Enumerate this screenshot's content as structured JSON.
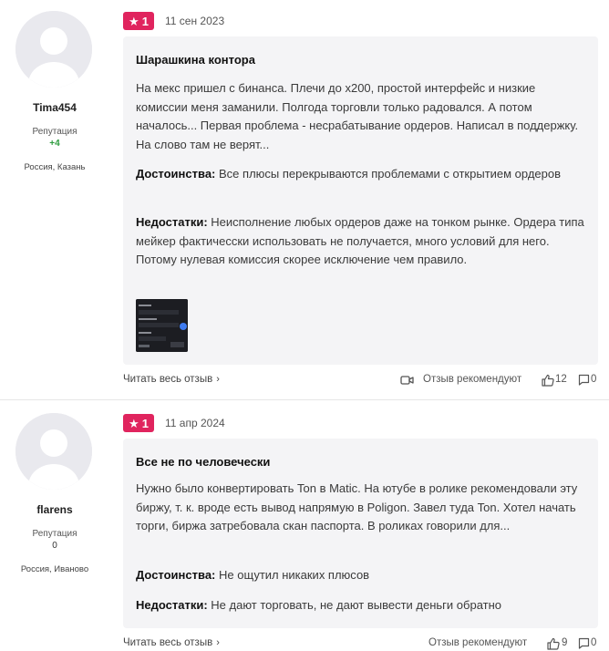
{
  "reviews": [
    {
      "author": "Tima454",
      "reputation_label": "Репутация",
      "reputation_value": "+4",
      "location": "Россия, Казань",
      "rating": "1",
      "date": "11 сен 2023",
      "title": "Шарашкина контора",
      "body": "На мекс пришел с бинанса. Плечи до х200, простой интерфейс и низкие комиссии меня заманили. Полгода торговли только радовался. А потом началось... Первая проблема - несрабатывание ордеров. Написал в поддержку. На слово там не верят...",
      "pros_label": "Достоинства:",
      "pros": "Все плюсы перекрываются проблемами с открытием ордеров",
      "cons_label": "Недостатки:",
      "cons": "Неисполнение любых ордеров даже на тонком рынке. Ордера типа мейкер фактичесски использовать не получается, много условий для него. Потому нулевая комиссия скорее исключение чем правило.",
      "read_more": "Читать весь отзыв",
      "recommend": "Отзыв рекомендуют",
      "likes": "12",
      "comments": "0"
    },
    {
      "author": "flarens",
      "reputation_label": "Репутация",
      "reputation_value": "0",
      "location": "Россия, Иваново",
      "rating": "1",
      "date": "11 апр 2024",
      "title": "Все не по человечески",
      "body": "Нужно было конвертировать Ton в Matic. На ютубе в ролике рекомендовали эту биржу, т. к. вроде есть вывод напрямую в Poligon. Завел туда Ton. Хотел начать торги, биржа затребовала скан паспорта. В роликах говорили для...",
      "pros_label": "Достоинства:",
      "pros": "Не ощутил никаких плюсов",
      "cons_label": "Недостатки:",
      "cons": "Не дают торговать, не дают вывести деньги обратно",
      "read_more": "Читать весь отзыв",
      "recommend": "Отзыв рекомендуют",
      "likes": "9",
      "comments": "0"
    }
  ],
  "colors": {
    "badge": "#e0245e",
    "positive_reputation": "#2e9c3f",
    "card_background": "#f4f4f6"
  },
  "icons": [
    "star-icon",
    "user-avatar-icon",
    "video-icon",
    "thumbs-up-icon",
    "comment-icon",
    "chevron-right-icon"
  ]
}
